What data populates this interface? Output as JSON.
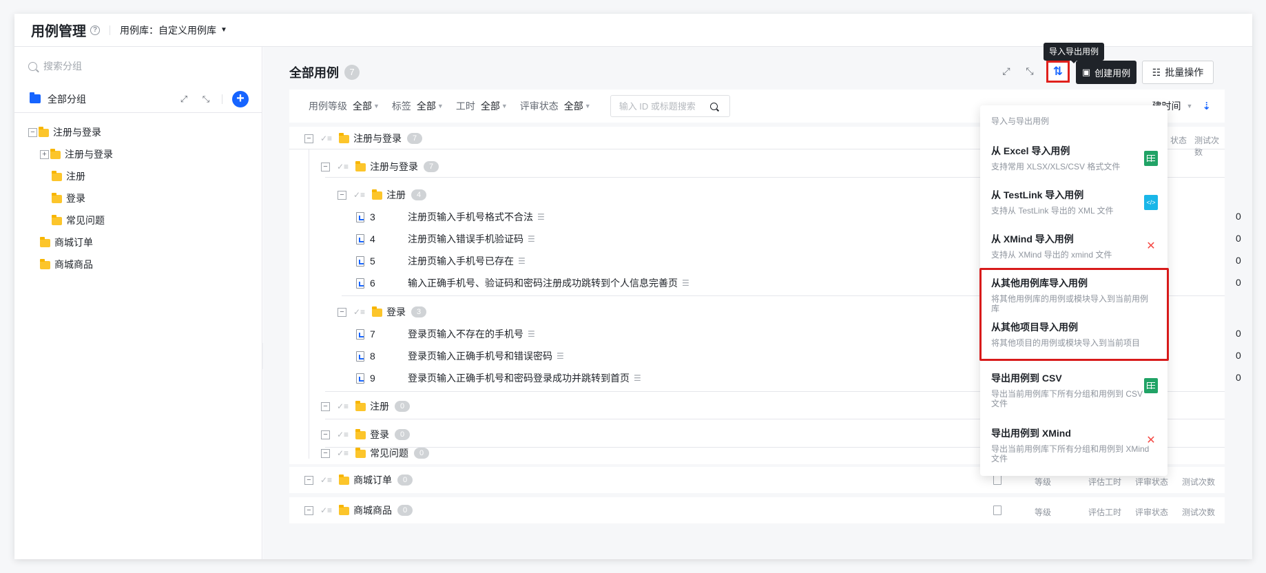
{
  "header": {
    "title": "用例管理",
    "library_label": "用例库：自定义用例库"
  },
  "sidebar": {
    "search_placeholder": "搜索分组",
    "all_group": "全部分组",
    "tree": [
      {
        "label": "注册与登录",
        "level": 0,
        "toggle": "−"
      },
      {
        "label": "注册与登录",
        "level": 1,
        "toggle": "+"
      },
      {
        "label": "注册",
        "level": 2,
        "toggle": ""
      },
      {
        "label": "登录",
        "level": 2,
        "toggle": ""
      },
      {
        "label": "常见问题",
        "level": 2,
        "toggle": ""
      },
      {
        "label": "商城订单",
        "level": 1,
        "toggle": ""
      },
      {
        "label": "商城商品",
        "level": 1,
        "toggle": ""
      }
    ]
  },
  "main": {
    "title": "全部用例",
    "count": "7",
    "tooltip": "导入导出用例",
    "create_label": "创建用例",
    "batch_label": "批量操作",
    "filters": [
      {
        "label": "用例等级",
        "value": "全部"
      },
      {
        "label": "标签",
        "value": "全部"
      },
      {
        "label": "工时",
        "value": "全部"
      },
      {
        "label": "评审状态",
        "value": "全部"
      }
    ],
    "search_placeholder": "输入 ID 或标题搜索",
    "sort_label": "建时间",
    "col_headers": {
      "level": "等级",
      "effort": "评估工时",
      "review": "评审状态",
      "tests": "测试次数",
      "status_partial": "状态"
    },
    "groups": {
      "g1": {
        "label": "注册与登录",
        "count": "7"
      },
      "g2": {
        "label": "注册与登录",
        "count": "7"
      },
      "g3": {
        "label": "注册",
        "count": "4"
      },
      "g4": {
        "label": "登录",
        "count": "3"
      },
      "g5": {
        "label": "注册",
        "count": "0"
      },
      "g6": {
        "label": "登录",
        "count": "0"
      },
      "g7": {
        "label": "常见问题",
        "count": "0"
      },
      "g8": {
        "label": "商城订单",
        "count": "0"
      },
      "g9": {
        "label": "商城商品",
        "count": "0"
      }
    },
    "cases": [
      {
        "id": "3",
        "title": "注册页输入手机号格式不合法",
        "tests": "0"
      },
      {
        "id": "4",
        "title": "注册页输入错误手机验证码",
        "tests": "0"
      },
      {
        "id": "5",
        "title": "注册页输入手机号已存在",
        "tests": "0"
      },
      {
        "id": "6",
        "title": "输入正确手机号、验证码和密码注册成功跳转到个人信息完善页",
        "tests": "0"
      },
      {
        "id": "7",
        "title": "登录页输入不存在的手机号",
        "tests": "0"
      },
      {
        "id": "8",
        "title": "登录页输入正确手机号和错误密码",
        "tests": "0"
      },
      {
        "id": "9",
        "title": "登录页输入正确手机号和密码登录成功并跳转到首页",
        "tests": "0"
      }
    ]
  },
  "dropdown": {
    "header": "导入与导出用例",
    "items": [
      {
        "title": "从 Excel 导入用例",
        "desc": "支持常用 XLSX/XLS/CSV 格式文件",
        "icon": "excel-icon"
      },
      {
        "title": "从 TestLink 导入用例",
        "desc": "支持从 TestLink 导出的 XML 文件",
        "icon": "testlink-icon"
      },
      {
        "title": "从 XMind 导入用例",
        "desc": "支持从 XMind 导出的 xmind 文件",
        "icon": "xmind-icon"
      },
      {
        "title": "从其他用例库导入用例",
        "desc": "将其他用例库的用例或模块导入到当前用例库",
        "icon": ""
      },
      {
        "title": "从其他项目导入用例",
        "desc": "将其他项目的用例或模块导入到当前项目",
        "icon": ""
      },
      {
        "title": "导出用例到 CSV",
        "desc": "导出当前用例库下所有分组和用例到 CSV 文件",
        "icon": "excel-icon"
      },
      {
        "title": "导出用例到 XMind",
        "desc": "导出当前用例库下所有分组和用例到 XMind 文件",
        "icon": "xmind-icon"
      }
    ]
  },
  "colors": {
    "accent": "#1664ff",
    "highlight": "#d81a1a",
    "folder": "#fcc52b"
  }
}
